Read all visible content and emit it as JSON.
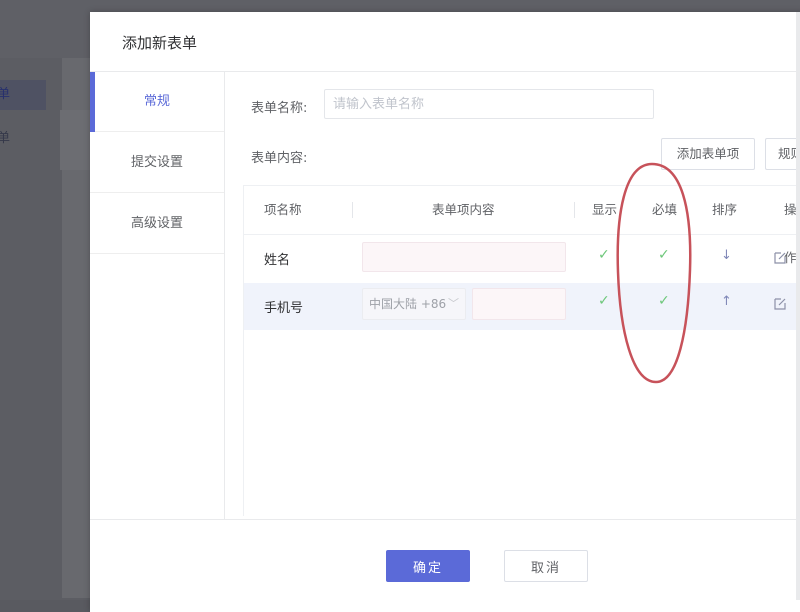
{
  "background": {
    "sidebar_items": [
      {
        "label": "单",
        "active": true
      },
      {
        "label": "单",
        "active": false
      }
    ]
  },
  "modal": {
    "title": "添加新表单",
    "tabs": [
      {
        "label": "常规",
        "active": true
      },
      {
        "label": "提交设置",
        "active": false
      },
      {
        "label": "高级设置",
        "active": false
      }
    ],
    "form_name_label": "表单名称:",
    "form_name_placeholder": "请输入表单名称",
    "form_name_value": "",
    "form_content_label": "表单内容:",
    "add_item_button": "添加表单项",
    "rules_button": "规则",
    "table": {
      "headers": {
        "name": "项名称",
        "content": "表单项内容",
        "show": "显示",
        "required": "必填",
        "sort": "排序",
        "action": "操作"
      },
      "rows": [
        {
          "name": "姓名",
          "show": "✓",
          "required": "✓",
          "sort": "↓",
          "highlighted": false
        },
        {
          "name": "手机号",
          "region_select": "中国大陆 +86",
          "show": "✓",
          "required": "✓",
          "sort": "↑",
          "highlighted": true
        }
      ]
    },
    "confirm_button": "确定",
    "cancel_button": "取消"
  },
  "icons": {
    "edit": "edit-icon",
    "check": "check-icon",
    "sort_down": "arrow-down-icon",
    "sort_up": "arrow-up-icon",
    "select_chevron": "chevron-down-icon"
  },
  "colors": {
    "accent": "#5b6ad8",
    "check": "#6dc77a",
    "annotation": "#c7525a",
    "row_highlight": "#f0f3fb"
  }
}
